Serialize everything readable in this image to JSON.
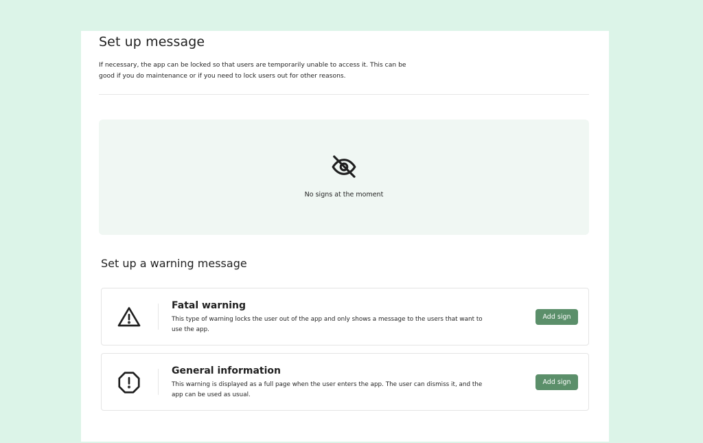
{
  "header": {
    "title": "Set up message",
    "description": "If necessary, the app can be locked so that users are temporarily unable to access it. This can be good if you do maintenance or if you need to lock users out for other reasons."
  },
  "empty_state": {
    "icon": "eye-off-icon",
    "text": "No signs at the moment"
  },
  "warning_section": {
    "title": "Set up a warning message",
    "items": [
      {
        "icon": "warning-triangle-icon",
        "title": "Fatal warning",
        "description": "This type of warning locks the user out of the app and only shows a message to the users that want to use the app.",
        "button_label": "Add sign"
      },
      {
        "icon": "alert-octagon-icon",
        "title": "General information",
        "description": "This warning is displayed as a full page when the user enters the app. The user can dismiss it, and the app can be used as usual.",
        "button_label": "Add sign"
      }
    ]
  },
  "colors": {
    "background": "#dcf4e8",
    "panel": "#ffffff",
    "empty_box": "#f0f7f3",
    "button": "#5b8f6a"
  }
}
